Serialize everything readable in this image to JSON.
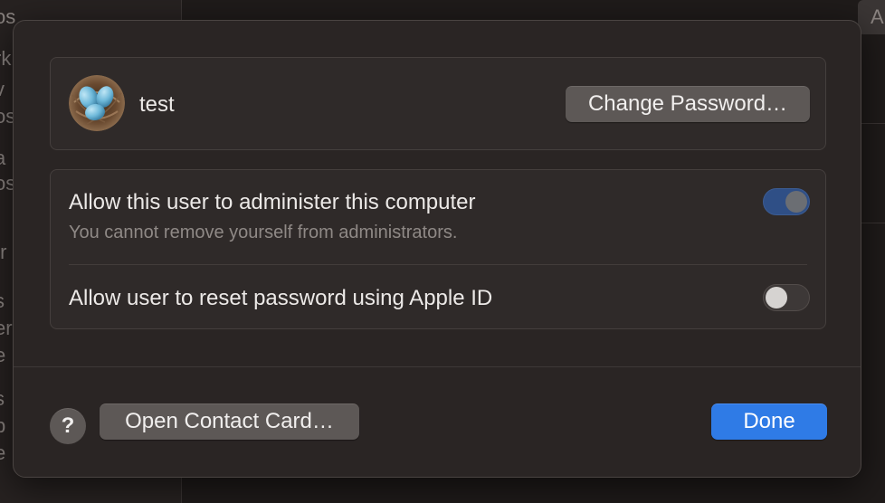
{
  "background": {
    "sidebar_fragments": [
      "os",
      "rk",
      "v",
      "os",
      "a",
      "os",
      "tr",
      "s",
      "er",
      "e",
      "s",
      "b",
      "e"
    ],
    "top_right_button_label": "A"
  },
  "sheet": {
    "user": {
      "name": "test",
      "avatar_icon": "bird-nest-eggs-avatar",
      "change_password_label": "Change Password…"
    },
    "options": [
      {
        "title": "Allow this user to administer this computer",
        "subtitle": "You cannot remove yourself from administrators.",
        "enabled": true,
        "disabled_control": true
      },
      {
        "title": "Allow user to reset password using Apple ID",
        "enabled": false
      }
    ],
    "footer": {
      "help_label": "?",
      "open_contact_card_label": "Open Contact Card…",
      "done_label": "Done"
    }
  },
  "colors": {
    "accent": "#2f7be6",
    "toggle_on": "#2f4f86",
    "sheet_bg": "#2a2524"
  }
}
